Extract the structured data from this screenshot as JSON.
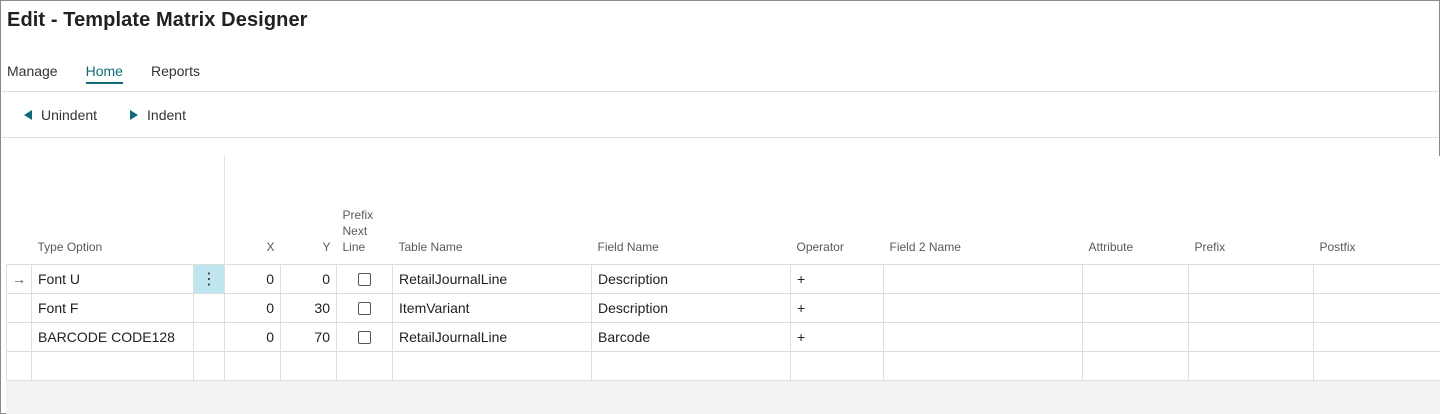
{
  "page": {
    "title": "Edit - Template Matrix Designer"
  },
  "tabs": [
    {
      "label": "Manage",
      "active": false
    },
    {
      "label": "Home",
      "active": true
    },
    {
      "label": "Reports",
      "active": false
    }
  ],
  "actions": {
    "unindent": {
      "label": "Unindent",
      "icon": "triangle-left-icon"
    },
    "indent": {
      "label": "Indent",
      "icon": "triangle-right-icon"
    }
  },
  "grid": {
    "columns": {
      "type_option": "Type Option",
      "x": "X",
      "y": "Y",
      "prefix_next_line": "Prefix Next Line",
      "table_name": "Table Name",
      "field_name": "Field Name",
      "operator": "Operator",
      "field2_name": "Field 2 Name",
      "attribute": "Attribute",
      "prefix": "Prefix",
      "postfix": "Postfix"
    },
    "current_row_indicator": "→",
    "row_menu_icon": "⋮",
    "rows": [
      {
        "type_option": "Font U",
        "x": "0",
        "y": "0",
        "prefix_next_line": false,
        "table_name": "RetailJournalLine",
        "field_name": "Description",
        "operator": "+",
        "field2_name": "",
        "attribute": "",
        "prefix": "",
        "postfix": ""
      },
      {
        "type_option": "Font F",
        "x": "0",
        "y": "30",
        "prefix_next_line": false,
        "table_name": "ItemVariant",
        "field_name": "Description",
        "operator": "+",
        "field2_name": "",
        "attribute": "",
        "prefix": "",
        "postfix": ""
      },
      {
        "type_option": "BARCODE CODE128",
        "x": "0",
        "y": "70",
        "prefix_next_line": false,
        "table_name": "RetailJournalLine",
        "field_name": "Barcode",
        "operator": "+",
        "field2_name": "",
        "attribute": "",
        "prefix": "",
        "postfix": ""
      }
    ]
  },
  "colors": {
    "accent": "#0f6b74",
    "row_menu_bg": "#bfe6ee"
  }
}
